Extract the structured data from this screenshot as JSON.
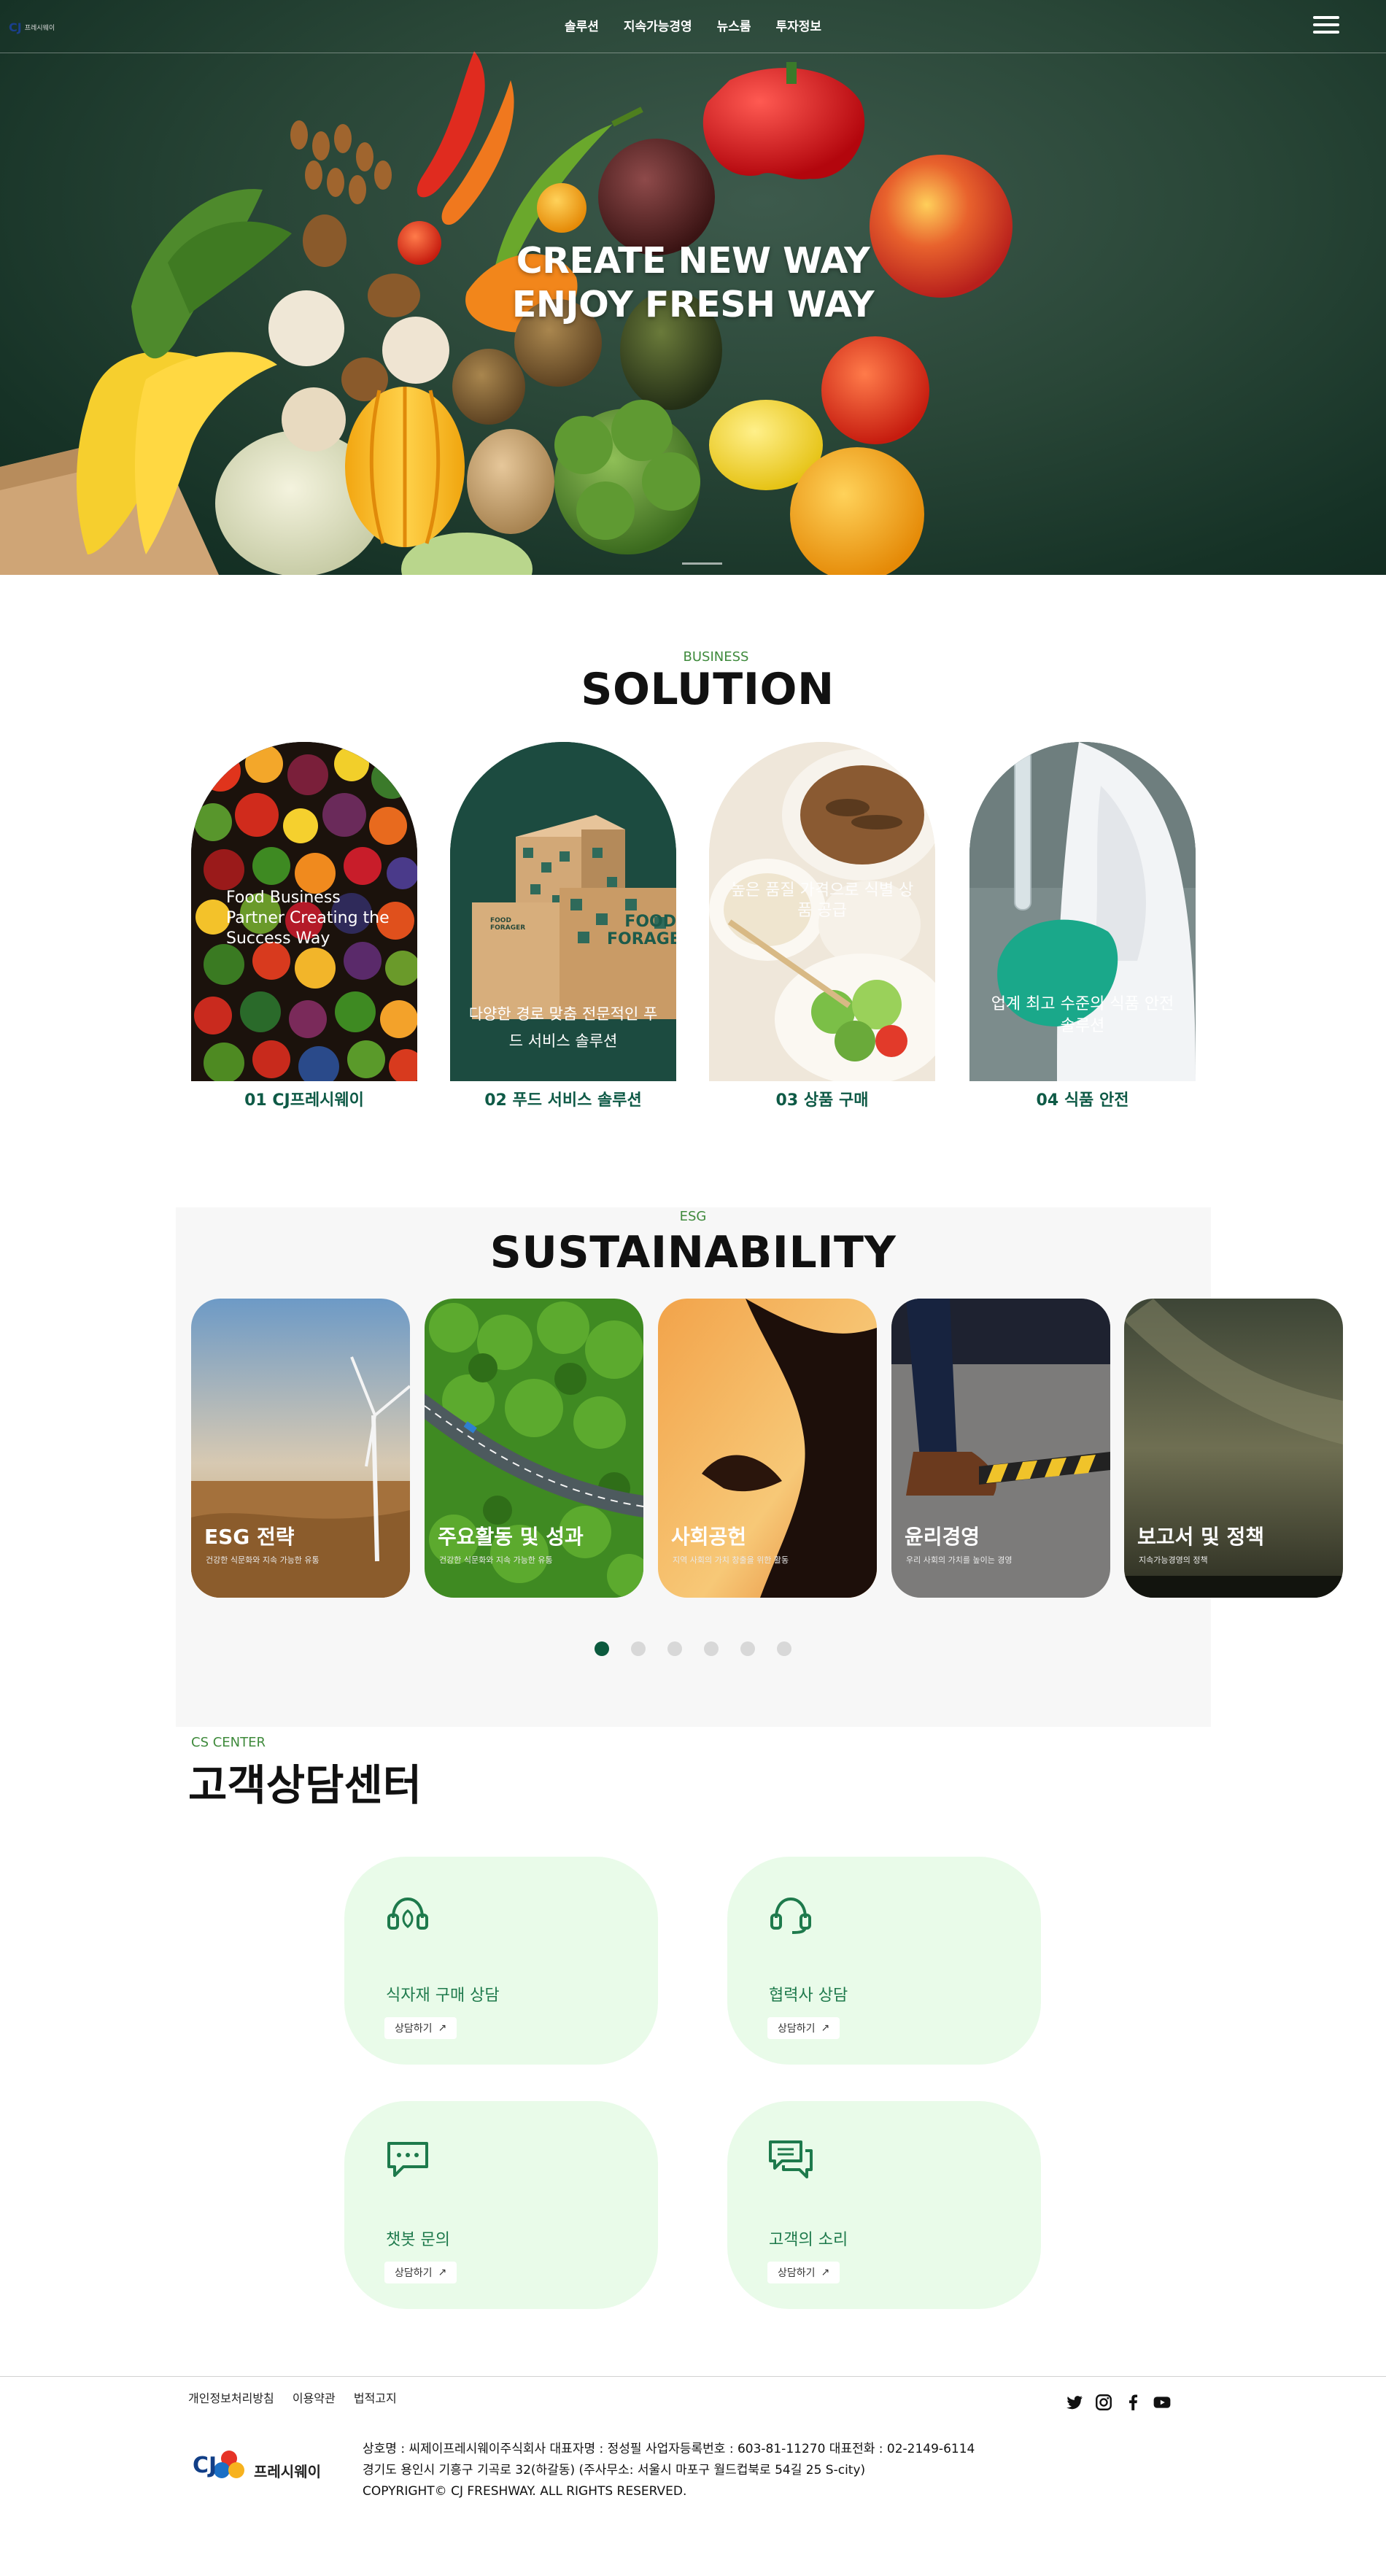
{
  "header": {
    "logo_mark": "CJ",
    "logo_name": "프레시웨이",
    "nav": [
      "솔루션",
      "지속가능경영",
      "뉴스룸",
      "투자정보"
    ]
  },
  "hero": {
    "title_line1": "CREATE NEW WAY",
    "title_line2": "ENJOY FRESH WAY"
  },
  "solution": {
    "eyebrow": "BUSINESS",
    "title": "SOLUTION",
    "cards": [
      {
        "text": "Food Business Partner Creating the Success Way",
        "label": "01 CJ프레시웨이"
      },
      {
        "text": "다양한 경로 맞춤 전문적인 푸드 서비스 솔루션",
        "label": "02 푸드 서비스 솔루션"
      },
      {
        "text": "높은 품질 가격으로 식별 상품 공급",
        "label": "03  상품 구매"
      },
      {
        "text": "업계 최고 수준의 식품 안전 솔루션",
        "label": "04 식품 안전"
      }
    ],
    "box_brand_1": "FOOD FORAGER",
    "box_brand_2": "FOOD FORAGER"
  },
  "sustainability": {
    "eyebrow": "ESG",
    "title": "SUSTAINABILITY",
    "cards": [
      {
        "title": "ESG 전략",
        "sub": "건강한 식문화와 지속 가능한 유통"
      },
      {
        "title": "주요활동 및 성과",
        "sub": "건강한 식문화와 지속 가능한 유통"
      },
      {
        "title": "사회공헌",
        "sub": "지역 사회의 가치 창출을 위한 활동"
      },
      {
        "title": "윤리경영",
        "sub": "우리 사회의 가치를 높이는 경영"
      },
      {
        "title": "보고서 및 정책",
        "sub": "지속가능경영의 정책"
      }
    ],
    "dots_count": 6,
    "active_dot": 1
  },
  "cs_center": {
    "eyebrow": "CS CENTER",
    "title": "고객상담센터",
    "cards": [
      {
        "title": "식자재 구매 상담",
        "button": "상담하기",
        "icon": "headset-leaf-icon"
      },
      {
        "title": "협력사 상담",
        "button": "상담하기",
        "icon": "headset-icon"
      },
      {
        "title": "챗봇 문의",
        "button": "상담하기",
        "icon": "chat-bubble-icon"
      },
      {
        "title": "고객의 소리",
        "button": "상담하기",
        "icon": "chat-bubbles-icon"
      }
    ]
  },
  "footer": {
    "links": [
      "개인정보처리방침",
      "이용약관",
      "법적고지"
    ],
    "logo_mark": "CJ",
    "logo_name": "프레시웨이",
    "info_line1": "상호명 : 씨제이프레시웨이주식회사 대표자명 : 정성필 사업자등록번호 : 603-81-11270 대표전화 : 02-2149-6114",
    "info_line2": "경기도 용인시 기흥구 기곡로 32(하갈동) (주사무소: 서울시 마포구 월드컵북로 54길 25 S-city)",
    "copyright": "COPYRIGHT© CJ FRESHWAY. ALL RIGHTS RESERVED.",
    "social": [
      "twitter-icon",
      "instagram-icon",
      "facebook-icon",
      "youtube-icon"
    ]
  },
  "colors": {
    "brand_green": "#0c5a3e",
    "eyebrow_green": "#3f8a3c",
    "cs_card_bg": "#e9fbe9",
    "esg_bg": "#f7f7f7"
  }
}
